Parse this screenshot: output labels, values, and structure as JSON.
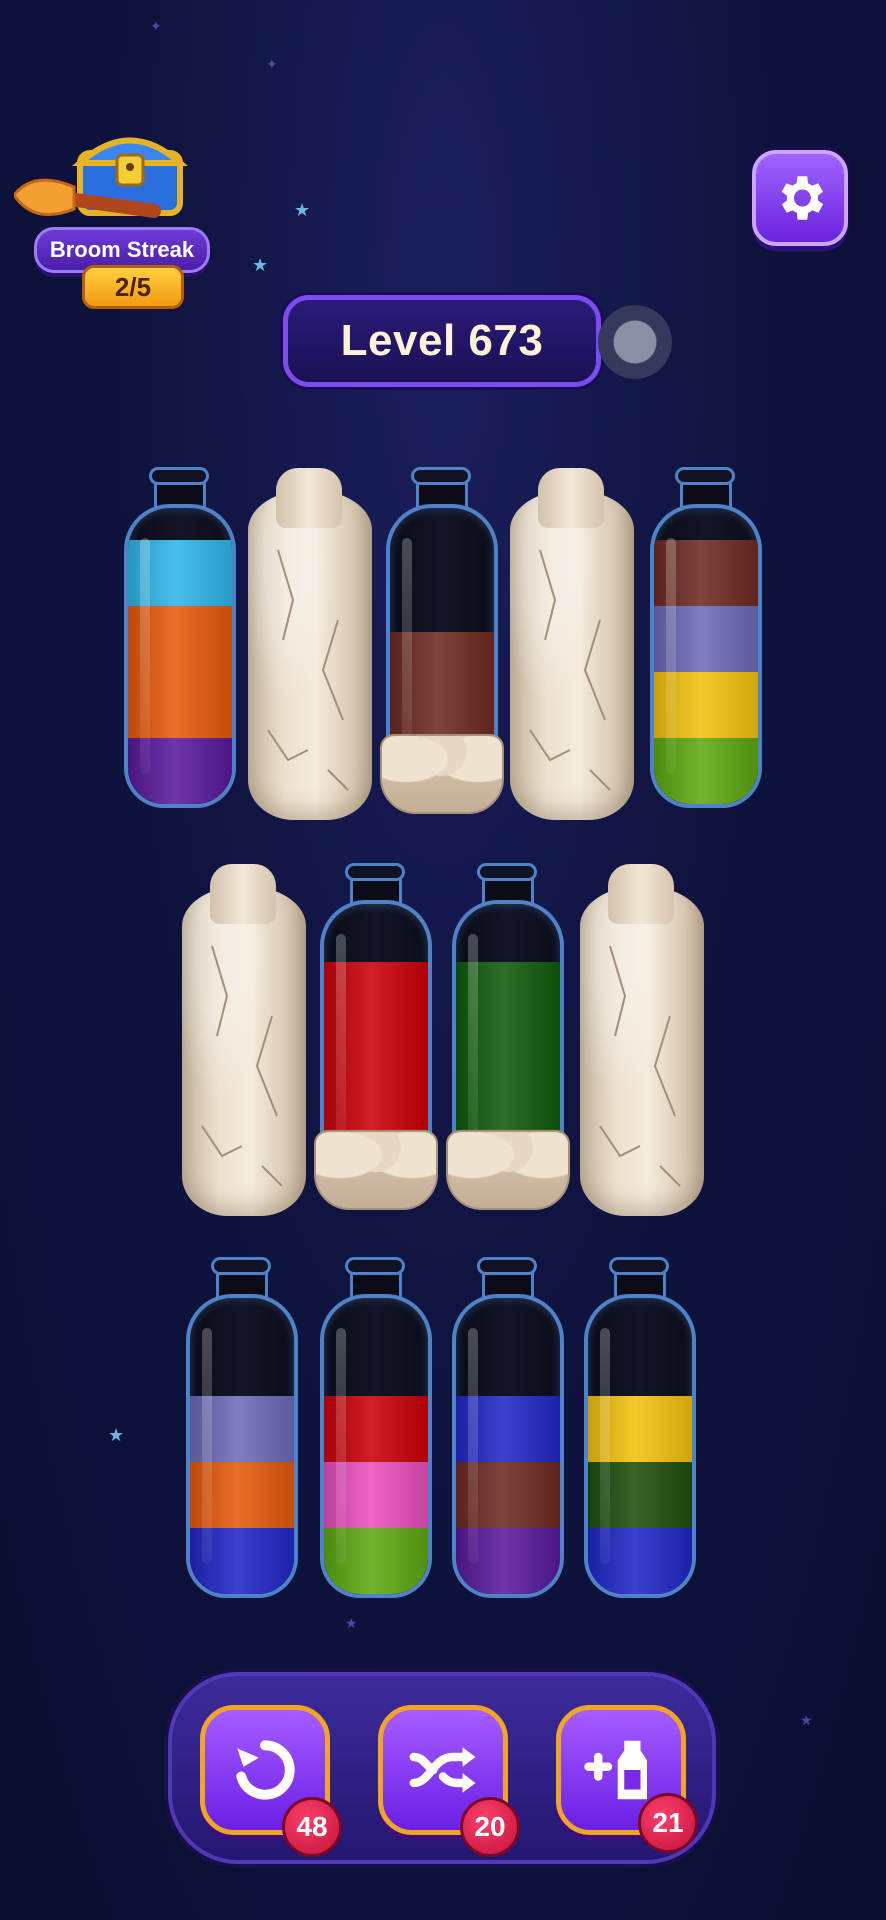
{
  "streak": {
    "title": "Broom Streak",
    "count": "2/5"
  },
  "level": {
    "label": "Level 673"
  },
  "toolbar": {
    "undo": {
      "count": "48",
      "icon": "undo-icon"
    },
    "shuffle": {
      "count": "20",
      "icon": "shuffle-icon"
    },
    "add_tube": {
      "count": "21",
      "icon": "add-bottle-icon"
    }
  },
  "colors": {
    "cyan": "#2fb6ea",
    "orange": "#e8590c",
    "purple": "#5a1a9e",
    "brown": "#6e2a22",
    "lavender": "#6d6aba",
    "yellow": "#f4c20d",
    "lime": "#5ea811",
    "red": "#cc0008",
    "green": "#0f5c0c",
    "pink": "#ea4fbf",
    "blue": "#2127c8",
    "darkgreen": "#1e4f10"
  },
  "tubes": {
    "row1": [
      {
        "state": "open",
        "layers": [
          "purple",
          "orange",
          "orange",
          "cyan"
        ]
      },
      {
        "state": "stone"
      },
      {
        "state": "locked",
        "layers": [
          "brown",
          "brown"
        ]
      },
      {
        "state": "stone"
      },
      {
        "state": "open",
        "layers": [
          "lime",
          "yellow",
          "lavender",
          "brown"
        ]
      }
    ],
    "row2": [
      {
        "state": "stone"
      },
      {
        "state": "locked",
        "layers": [
          "red",
          "red",
          "red"
        ]
      },
      {
        "state": "locked",
        "layers": [
          "green",
          "green",
          "green"
        ]
      },
      {
        "state": "stone"
      }
    ],
    "row3": [
      {
        "state": "open",
        "layers": [
          "blue",
          "orange",
          "lavender"
        ]
      },
      {
        "state": "open",
        "layers": [
          "lime",
          "pink",
          "red"
        ]
      },
      {
        "state": "open",
        "layers": [
          "purple",
          "brown",
          "blue"
        ]
      },
      {
        "state": "open",
        "layers": [
          "blue",
          "darkgreen",
          "yellow"
        ]
      }
    ]
  }
}
